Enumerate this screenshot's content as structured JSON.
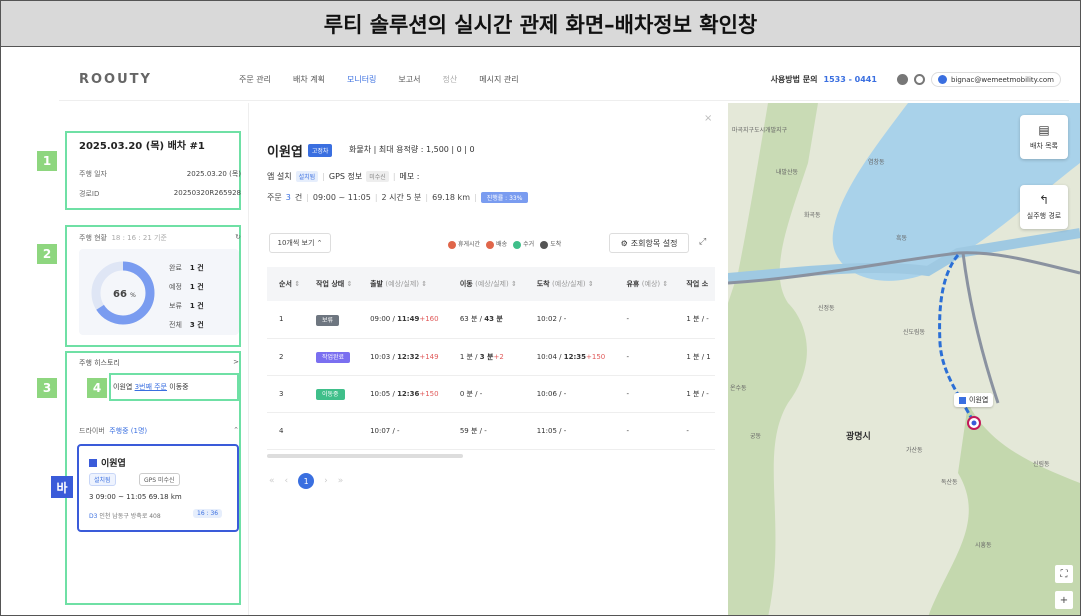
{
  "caption": "루티 솔루션의 실시간 관제 화면–배차정보 확인창",
  "header": {
    "logo": "ROOUTY",
    "nav": [
      {
        "label": "주문 관리",
        "state": "normal"
      },
      {
        "label": "배차 계획",
        "state": "normal"
      },
      {
        "label": "모니터링",
        "state": "active"
      },
      {
        "label": "보고서",
        "state": "normal"
      },
      {
        "label": "정산",
        "state": "muted"
      },
      {
        "label": "메시지 관리",
        "state": "normal"
      }
    ],
    "support_label": "사용방법 문의",
    "support_number": "1533 - 0441",
    "user_email": "bignac@wemeetmobility.com"
  },
  "annotations": {
    "b1": "1",
    "b2": "2",
    "b3": "3",
    "b4": "4",
    "b5": "바"
  },
  "dispatch": {
    "title": "2025.03.20 (목) 배차 #1",
    "date_label": "주행 일자",
    "date_value": "2025.03.20 (목)",
    "id_label": "경로ID",
    "id_value": "20250320R265928"
  },
  "status": {
    "title": "주행 현황",
    "time": "18 : 16 : 21 기준",
    "percent_text": "66",
    "percent_unit": "%",
    "completion": 0.66,
    "rows": [
      {
        "label": "완료",
        "value": "1 건"
      },
      {
        "label": "예정",
        "value": "1 건"
      },
      {
        "label": "보류",
        "value": "1 건"
      },
      {
        "label": "전체",
        "value": "3 건"
      }
    ]
  },
  "history": {
    "title": "주행 히스토리",
    "chev": ">",
    "prefix": "이원엽",
    "link": "3번째 주문",
    "suffix": "이동중"
  },
  "driver_filter": {
    "label": "드라이버",
    "value": "주행중 (1명)",
    "caret": "⌃"
  },
  "driver_card": {
    "name": "이원엽",
    "tag_installed": "설치됨",
    "tag_gps": "GPS 미수신",
    "schedule": "3   09:00 ~ 11:05   69.18 km",
    "addr_code": "D3",
    "addr": "인천 남동구 방축로 408",
    "time": "16 : 36"
  },
  "detail": {
    "name": "이원엽",
    "chip": "고정차",
    "vehicle": "화물차  |  최대 용적량 : 1,500  |  0  |  0",
    "app_label": "앱 설치",
    "app_value": "설치됨",
    "gps_label": "GPS 정보",
    "gps_value": "미수신",
    "memo_label": "메모 :",
    "order_label": "주문",
    "order_count": "3",
    "order_unit": "건",
    "time_range": "09:00 ~ 11:05",
    "duration": "2 시간 5 분",
    "distance": "69.18 km",
    "progress": "진행률 : 33%",
    "close": "×"
  },
  "table": {
    "page_size": "10개씩 보기  ⌃",
    "legend": [
      {
        "label": "휴게시간",
        "color": "#e0664a"
      },
      {
        "label": "배송",
        "color": "#e0664a"
      },
      {
        "label": "수거",
        "color": "#3fbf8a"
      },
      {
        "label": "도착",
        "color": "#555555"
      }
    ],
    "col_setting": "조회항목 설정",
    "headers": [
      {
        "label": "순서",
        "unit": "⇕"
      },
      {
        "label": "작업 상태",
        "unit": "⇕"
      },
      {
        "label": "출발",
        "unit": "(예상/실제)  ⇕"
      },
      {
        "label": "이동",
        "unit": "(예상/실제)  ⇕"
      },
      {
        "label": "도착",
        "unit": "(예상/실제)  ⇕"
      },
      {
        "label": "유휴",
        "unit": "(예상)  ⇕"
      },
      {
        "label": "작업 소",
        "unit": ""
      }
    ],
    "rows": [
      {
        "seq": "1",
        "status": "보류",
        "status_color": "grey",
        "dep_a": "09:00 / ",
        "dep_b": "11:49",
        "dep_c": "+160",
        "move_a": "63 분 / ",
        "move_b": "43 분",
        "move_c": "",
        "arr_a": "10:02 / -",
        "arr_b": "",
        "arr_c": "",
        "idle": "-",
        "work": "1 분 / -"
      },
      {
        "seq": "2",
        "status": "작업완료",
        "status_color": "purple",
        "dep_a": "10:03 / ",
        "dep_b": "12:32",
        "dep_c": "+149",
        "move_a": "1 분 / ",
        "move_b": "3 분",
        "move_c": "+2",
        "arr_a": "10:04 / ",
        "arr_b": "12:35",
        "arr_c": "+150",
        "idle": "-",
        "work": "1 분 / 1"
      },
      {
        "seq": "3",
        "status": "이동중",
        "status_color": "green",
        "dep_a": "10:05 / ",
        "dep_b": "12:36",
        "dep_c": "+150",
        "move_a": "0 분 / -",
        "move_b": "",
        "move_c": "",
        "arr_a": "10:06 / -",
        "arr_b": "",
        "arr_c": "",
        "idle": "-",
        "work": "1 분 / -"
      },
      {
        "seq": "4",
        "status": "",
        "status_color": "",
        "dep_a": "10:07 / -",
        "dep_b": "",
        "dep_c": "",
        "move_a": "59 분 / -",
        "move_b": "",
        "move_c": "",
        "arr_a": "11:05 / -",
        "arr_b": "",
        "arr_c": "",
        "idle": "-",
        "work": "-"
      }
    ],
    "pager": {
      "first": "«",
      "prev": "‹",
      "current": "1",
      "next": "›",
      "last": "»"
    }
  },
  "map": {
    "btn_list": "배차 목록",
    "btn_route": "실주행 경로",
    "city": "광명시",
    "marker": "이원엽",
    "labels": [
      {
        "t": "마곡지구도시개발지구"
      },
      {
        "t": "염창동"
      },
      {
        "t": "내발산동"
      },
      {
        "t": "화곡동"
      },
      {
        "t": "신정동"
      },
      {
        "t": "신도림동"
      },
      {
        "t": "온수동"
      },
      {
        "t": "궁동"
      },
      {
        "t": "가산동"
      },
      {
        "t": "독산동"
      },
      {
        "t": "신림동"
      },
      {
        "t": "시흥동"
      },
      {
        "t": "흑동"
      }
    ],
    "zoom_full": "⛶",
    "zoom_plus": "+"
  }
}
